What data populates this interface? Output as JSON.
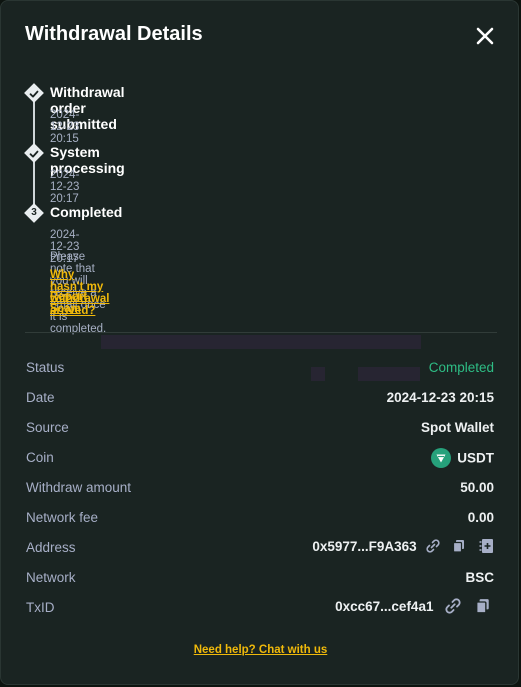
{
  "modal": {
    "title": "Withdrawal Details",
    "close_icon": "close-icon"
  },
  "timeline": {
    "steps": [
      {
        "title": "Withdrawal order submitted",
        "time": "2024-12-23 20:15",
        "marker": "check"
      },
      {
        "title": "System processing",
        "time": "2024-12-23 20:17",
        "marker": "check"
      },
      {
        "title": "Completed",
        "time": "2024-12-23 20:17",
        "marker": "3"
      }
    ],
    "note": "Please note that you will receive a email once it is completed.",
    "why_link": "Why hasn't my withdrawal arrived?",
    "report_link": "Report Scam"
  },
  "details": {
    "status": {
      "label": "Status",
      "value": "Completed"
    },
    "date": {
      "label": "Date",
      "value": "2024-12-23 20:15"
    },
    "source": {
      "label": "Source",
      "value": "Spot Wallet"
    },
    "coin": {
      "label": "Coin",
      "value": "USDT",
      "icon": "tether-icon"
    },
    "withdraw_amount": {
      "label": "Withdraw amount",
      "value": "50.00"
    },
    "network_fee": {
      "label": "Network fee",
      "value": "0.00"
    },
    "address": {
      "label": "Address",
      "value": "0x5977...F9A363"
    },
    "network": {
      "label": "Network",
      "value": "BSC"
    },
    "txid": {
      "label": "TxID",
      "value": "0xcc67...cef4a1"
    }
  },
  "footer": {
    "help_link": "Need help? Chat with us"
  },
  "colors": {
    "accent": "#f0b90b",
    "success": "#2ebd85",
    "background": "#1a2422"
  }
}
